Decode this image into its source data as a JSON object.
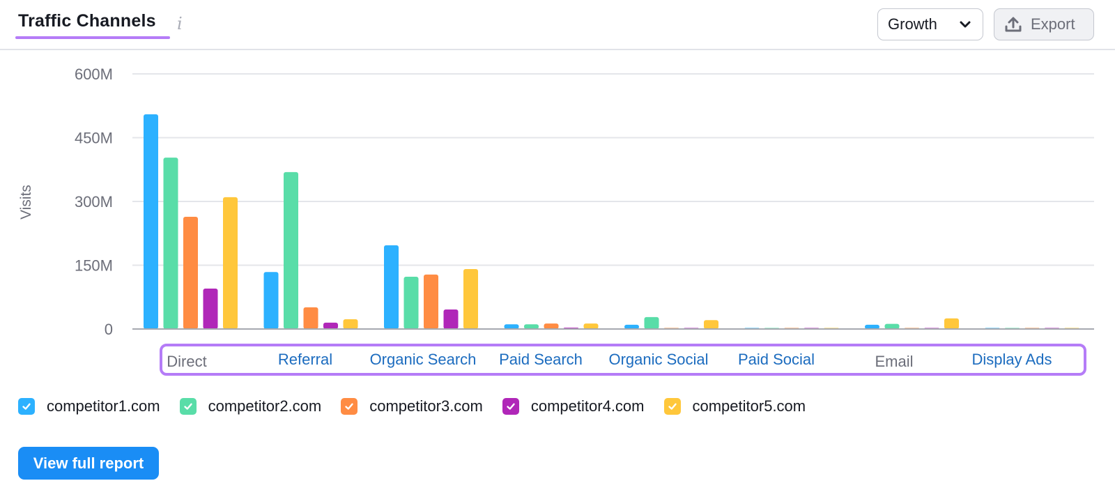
{
  "header": {
    "title": "Traffic Channels",
    "info_icon": "info-icon",
    "growth_select": {
      "label": "Growth",
      "icon": "chevron-down-icon"
    },
    "export_button": {
      "label": "Export",
      "icon": "upload-icon"
    }
  },
  "colors": {
    "accent_highlight": "#b57cf7",
    "link": "#1c6cbf",
    "primary_button": "#1a8df5"
  },
  "chart_data": {
    "type": "bar",
    "title": "Traffic Channels",
    "xlabel": "",
    "ylabel": "Visits",
    "ylim": [
      0,
      600000000
    ],
    "yticks": [
      0,
      150000000,
      300000000,
      450000000,
      600000000
    ],
    "ytick_labels": [
      "0",
      "150M",
      "300M",
      "450M",
      "600M"
    ],
    "grid": true,
    "legend_position": "bottom-left",
    "categories": [
      "Direct",
      "Referral",
      "Organic Search",
      "Paid Search",
      "Organic Social",
      "Paid Social",
      "Email",
      "Display Ads"
    ],
    "category_is_link": [
      false,
      true,
      true,
      true,
      true,
      true,
      false,
      true
    ],
    "series": [
      {
        "name": "competitor1.com",
        "color": "#2cb1ff",
        "values": [
          505000000,
          134000000,
          197000000,
          11000000,
          10000000,
          500000,
          10000000,
          500000
        ]
      },
      {
        "name": "competitor2.com",
        "color": "#59dda8",
        "values": [
          403000000,
          369000000,
          123000000,
          11000000,
          28000000,
          500000,
          12000000,
          500000
        ]
      },
      {
        "name": "competitor3.com",
        "color": "#ff8c43",
        "values": [
          264000000,
          51000000,
          128000000,
          13000000,
          1000000,
          500000,
          1000000,
          300000
        ]
      },
      {
        "name": "competitor4.com",
        "color": "#b027b8",
        "values": [
          95000000,
          15000000,
          46000000,
          3000000,
          1000000,
          200000,
          1000000,
          200000
        ]
      },
      {
        "name": "competitor5.com",
        "color": "#ffc73b",
        "values": [
          310000000,
          23000000,
          141000000,
          13000000,
          21000000,
          300000,
          25000000,
          300000
        ]
      }
    ]
  },
  "legend": {
    "items": [
      {
        "label": "competitor1.com",
        "checked": true
      },
      {
        "label": "competitor2.com",
        "checked": true
      },
      {
        "label": "competitor3.com",
        "checked": true
      },
      {
        "label": "competitor4.com",
        "checked": true
      },
      {
        "label": "competitor5.com",
        "checked": true
      }
    ]
  },
  "footer": {
    "report_button": "View full report"
  }
}
